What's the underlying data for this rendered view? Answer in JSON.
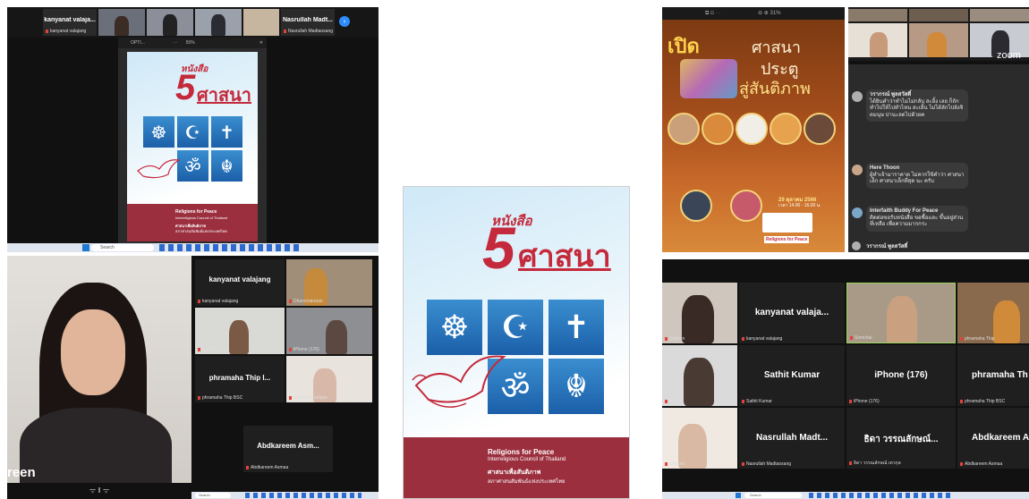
{
  "shot1": {
    "top_names": [
      "kanyanat valaja...",
      "Nasrullah Madt..."
    ],
    "top_labels": [
      "kanyanat valajang",
      "Nasrullah Madtaosang"
    ],
    "window_title": "OPTI...",
    "zoom": "55%",
    "search_placeholder": "Search"
  },
  "book": {
    "small_title": "หนังสือ",
    "number": "5",
    "word": "ศาสนา",
    "footer_main": "Religions for Peace",
    "footer_sub": "Interreligious Council of Thailand",
    "footer_thai1": "ศาสนาเพื่อสันติภาพ",
    "footer_thai2": "สภาศาสนสัมพันธ์แห่งประเทศไทย"
  },
  "shot2": {
    "caption": "reen",
    "tiles": [
      {
        "name": "kanyanat valajang",
        "label": "kanyanat valajang"
      },
      {
        "name": "",
        "label": "Dhammakatan"
      },
      {
        "name": "",
        "label": "Sathit Kumar"
      },
      {
        "name": "",
        "label": "iPhone (176)"
      },
      {
        "name": "phramaha Thip I...",
        "label": "phramaha Thip BSC"
      },
      {
        "name": "",
        "label": "Siriporn nnamjan"
      },
      {
        "name": "Abdkareem Asm...",
        "label": "Abdkareem Asmaa"
      }
    ],
    "search_placeholder": "Search"
  },
  "poster": {
    "title1": "เปิด",
    "title2": "ศาสนา",
    "title3": "ประตู",
    "title4": "สู่สันติภาพ",
    "date": "29 ตุลาคม 2566",
    "time": "เวลา 14.00 - 16.00 น.",
    "brand": "Religions for Peace",
    "zoom": "31%"
  },
  "chat": {
    "brand": "zoom",
    "messages": [
      {
        "sender": "วรากรณ์ พูลสวัสดิ์",
        "text": "ได้ยินคำว่าทำไมไม่กลับ สะอิ้ง เลย ก็ถักทำไปให้ไปทำไหน สะเอิ้น ไม่ได้ลักไปยังจิตมนุษ ปานะลดไปด้วยค"
      },
      {
        "sender": "Here Thoon",
        "text": "ผู้ทำเจ้ามาราคาต ไม่ควรใช้คำว่า ศาสนาเล็ก ศาสนาเล็กที่สุด นะ ครับ"
      },
      {
        "sender": "Interfaith Buddy For Peace",
        "text": "ติดต่อขอรับหนังสือ ขอซื้อและ ขึ้นอยู่ส่วนที่เหลือ เพื่อความมากกระ"
      },
      {
        "sender": "วรากรณ์ พูลสวัสดิ์",
        "text": ""
      }
    ]
  },
  "shot4": {
    "tiles": [
      {
        "name": "",
        "label": "Siriporn"
      },
      {
        "name": "kanyanat valaja...",
        "label": "kanyanat valajang"
      },
      {
        "name": "",
        "label": "Somchai"
      },
      {
        "name": "",
        "label": "phramaha Thip"
      },
      {
        "name": "",
        "label": "Sathit"
      },
      {
        "name": "Sathit Kumar",
        "label": "Sathit Kumar"
      },
      {
        "name": "iPhone (176)",
        "label": "iPhone (176)"
      },
      {
        "name": "phramaha Th",
        "label": "phramaha Thip BSC"
      },
      {
        "name": "",
        "label": "Siriporn"
      },
      {
        "name": "Nasrullah Madt...",
        "label": "Nasrullah Madtaosang"
      },
      {
        "name": "ธิดา วรรณลักษณ์...",
        "label": "ธิดา วรรณลักษณ์ เทวกุล"
      },
      {
        "name": "Abdkareem A",
        "label": "Abdkareem Asmaa"
      }
    ],
    "search_placeholder": "Search"
  },
  "colors": {
    "book_red": "#c42a3b",
    "symbol_blue": "#2b78c0",
    "footer_red": "#9b2f3e",
    "zoom_dark": "#1f1f1f"
  }
}
